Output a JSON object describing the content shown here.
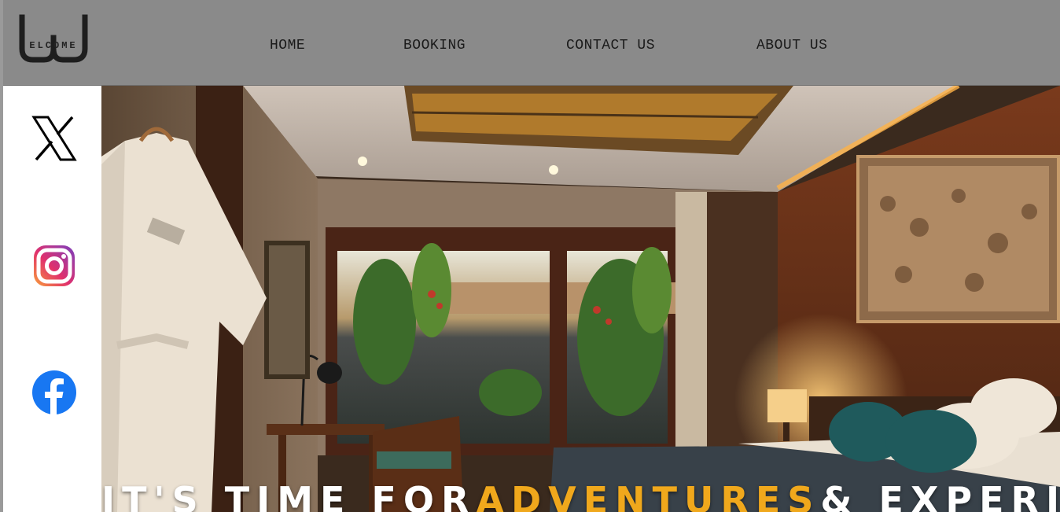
{
  "brand": {
    "logo_text": "ELCOME",
    "logo_letter": "W"
  },
  "nav": {
    "items": [
      {
        "label": "HOME"
      },
      {
        "label": "BOOKING"
      },
      {
        "label": "CONTACT US"
      },
      {
        "label": "ABOUT US"
      }
    ]
  },
  "social": {
    "icons": [
      "x-icon",
      "instagram-icon",
      "facebook-icon"
    ]
  },
  "hero": {
    "title_part1": "IT'S TIME FOR",
    "title_accent": "ADVENTURES",
    "title_part2": "& EXPERIENCES",
    "accent_color": "#f0a81c"
  },
  "colors": {
    "header_bg": "#8a8a8a",
    "nav_text": "#1a1a1a",
    "sidebar_bg": "#ffffff"
  }
}
